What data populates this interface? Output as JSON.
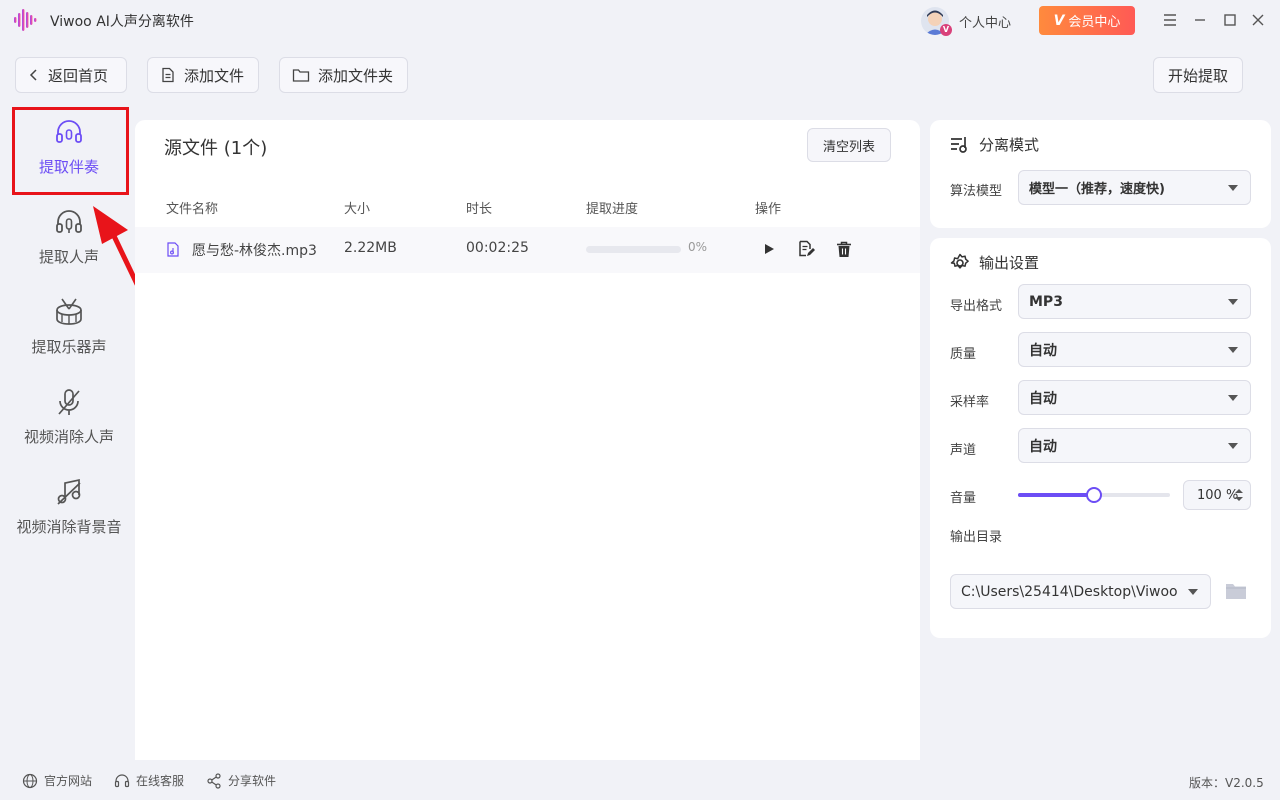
{
  "app": {
    "title": "Viwoo AI人声分离软件"
  },
  "header": {
    "user_center": "个人中心",
    "vip_label": "会员中心",
    "vip_mark": "V",
    "avatar_badge": "V"
  },
  "toolbar": {
    "back_home": "返回首页",
    "add_file": "添加文件",
    "add_folder": "添加文件夹",
    "start": "开始提取"
  },
  "sidebar": {
    "items": [
      {
        "label": "提取伴奏",
        "icon": "headphones-icon",
        "active": true
      },
      {
        "label": "提取人声",
        "icon": "headset-mic-icon",
        "active": false
      },
      {
        "label": "提取乐器声",
        "icon": "drum-icon",
        "active": false
      },
      {
        "label": "视频消除人声",
        "icon": "mic-off-icon",
        "active": false
      },
      {
        "label": "视频消除背景音",
        "icon": "music-off-icon",
        "active": false
      }
    ]
  },
  "files_panel": {
    "title": "源文件 (1个)",
    "clear_label": "清空列表",
    "columns": [
      "文件名称",
      "大小",
      "时长",
      "提取进度",
      "操作"
    ],
    "rows": [
      {
        "name": "愿与愁-林俊杰.mp3",
        "size": "2.22MB",
        "duration": "00:02:25",
        "progress": 0,
        "progress_text": "0%"
      }
    ]
  },
  "separation": {
    "title": "分离模式",
    "model_label": "算法模型",
    "model_value": "模型一（推荐，速度快)"
  },
  "output": {
    "title": "输出设置",
    "format_label": "导出格式",
    "format_value": "MP3",
    "quality_label": "质量",
    "quality_value": "自动",
    "sample_label": "采样率",
    "sample_value": "自动",
    "channel_label": "声道",
    "channel_value": "自动",
    "volume_label": "音量",
    "volume_value": 100,
    "volume_text": "100 %",
    "volume_slider_fraction": 0.5,
    "dir_label": "输出目录",
    "dir_value": "C:\\Users\\25414\\Desktop\\Viwoo"
  },
  "footer": {
    "website": "官方网站",
    "support": "在线客服",
    "share": "分享软件",
    "version": "版本：V2.0.5"
  },
  "colors": {
    "accent": "#6c4df5",
    "highlight": "#e8141a",
    "vip_start": "#ff8a3d",
    "vip_end": "#ff5a55"
  }
}
